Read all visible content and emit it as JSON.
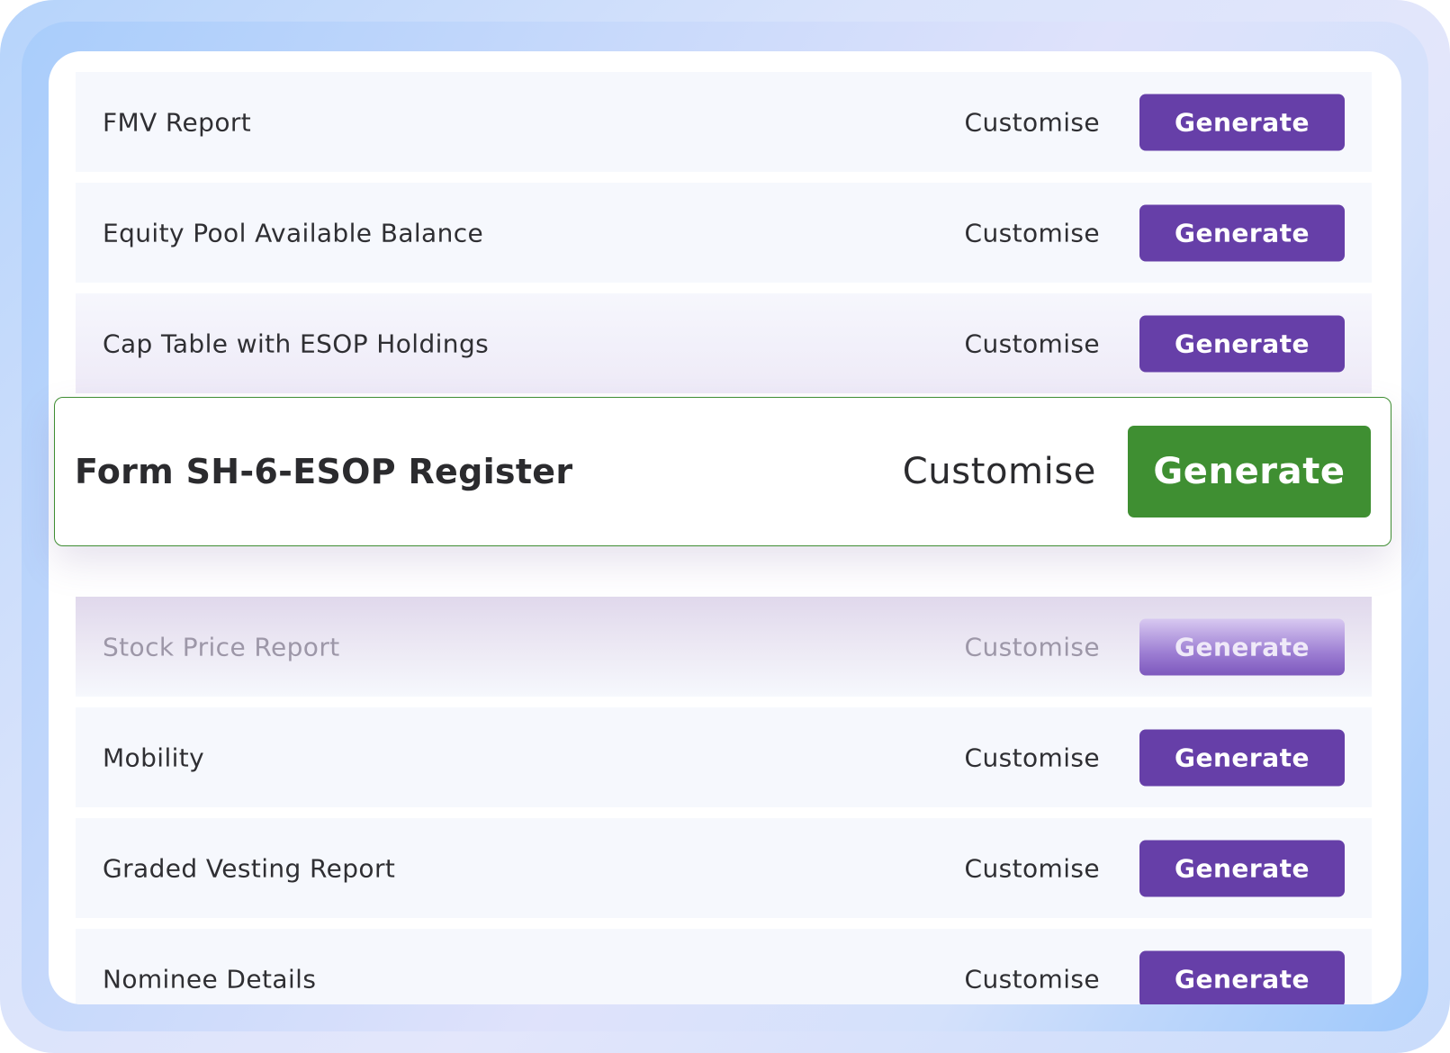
{
  "reports": [
    {
      "label": "FMV Report",
      "customise": "Customise",
      "generate": "Generate"
    },
    {
      "label": "Equity Pool Available Balance",
      "customise": "Customise",
      "generate": "Generate"
    },
    {
      "label": "Cap Table with ESOP Holdings",
      "customise": "Customise",
      "generate": "Generate"
    },
    {
      "label": "Stock Price Report",
      "customise": "Customise",
      "generate": "Generate"
    },
    {
      "label": "Mobility",
      "customise": "Customise",
      "generate": "Generate"
    },
    {
      "label": "Graded Vesting Report",
      "customise": "Customise",
      "generate": "Generate"
    },
    {
      "label": "Nominee Details",
      "customise": "Customise",
      "generate": "Generate"
    }
  ],
  "highlighted": {
    "label": "Form SH-6-ESOP Register",
    "customise": "Customise",
    "generate": "Generate"
  },
  "colors": {
    "generate_button": "#663fa8",
    "highlighted_generate_button": "#3f8f32",
    "highlight_border": "#3f8d33"
  }
}
